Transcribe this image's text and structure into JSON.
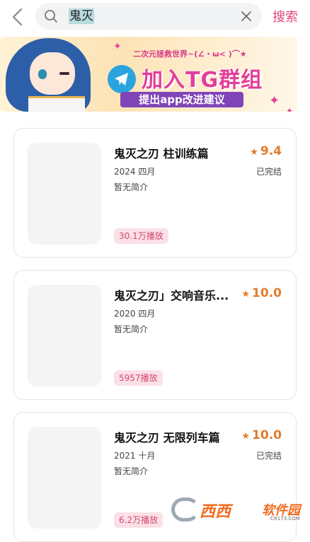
{
  "search": {
    "query": "鬼灭",
    "button_label": "搜索"
  },
  "banner": {
    "tagline": "二次元拯救世界~(∠・ω< )⌒★",
    "headline": "加入TG群组",
    "subline": "提出app改进建议"
  },
  "results": [
    {
      "title": "鬼灭之刃 柱训练篇",
      "rating": "9.4",
      "date": "2024 四月",
      "status": "已完结",
      "desc": "暂无简介",
      "plays": "30.1万播放"
    },
    {
      "title": "鬼灭之刃」交响音乐...",
      "rating": "10.0",
      "date": "2020 四月",
      "status": "",
      "desc": "暂无简介",
      "plays": "5957播放"
    },
    {
      "title": "鬼灭之刃 无限列车篇",
      "rating": "10.0",
      "date": "2021 十月",
      "status": "已完结",
      "desc": "暂无简介",
      "plays": "6.2万播放"
    }
  ],
  "watermark": {
    "brand": "西西",
    "suffix": "软件园",
    "url": "CR173.COM"
  },
  "colors": {
    "accent": "#e0457d",
    "rating": "#e07b2b",
    "plays_bg": "#fbe0e8"
  }
}
